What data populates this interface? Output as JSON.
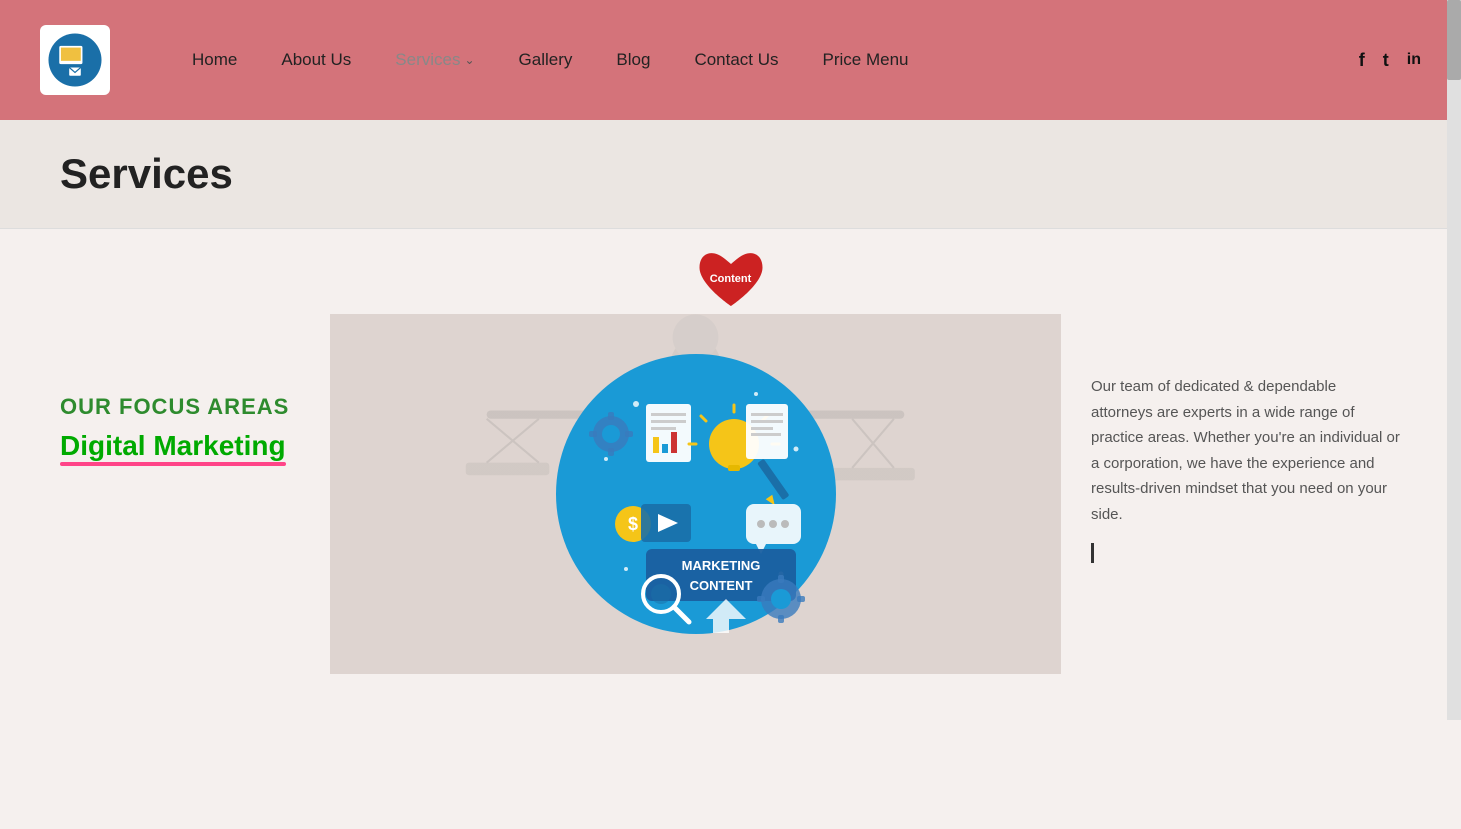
{
  "header": {
    "logo_alt": "Law Firm Logo",
    "nav": {
      "home": "Home",
      "about_us": "About Us",
      "services": "Services",
      "gallery": "Gallery",
      "blog": "Blog",
      "contact_us": "Contact Us",
      "price_menu": "Price Menu"
    },
    "social": {
      "facebook": "f",
      "twitter": "t",
      "linkedin": "in"
    },
    "bg_color": "#d4737a"
  },
  "page_title": "Services",
  "heart_badge": {
    "label": "Content",
    "color": "#cc2222"
  },
  "left_panel": {
    "focus_title": "OUR FOCUS AREAS",
    "focus_subtitle": "Digital Marketing"
  },
  "right_panel": {
    "text": "Our team of dedicated & dependable attorneys are experts in a wide range of practice areas. Whether you're an individual or a corporation, we have the experience and results-driven mindset that you need on your side."
  },
  "center_image": {
    "circle_title": "MARKETING",
    "circle_subtitle": "CONTENT"
  }
}
